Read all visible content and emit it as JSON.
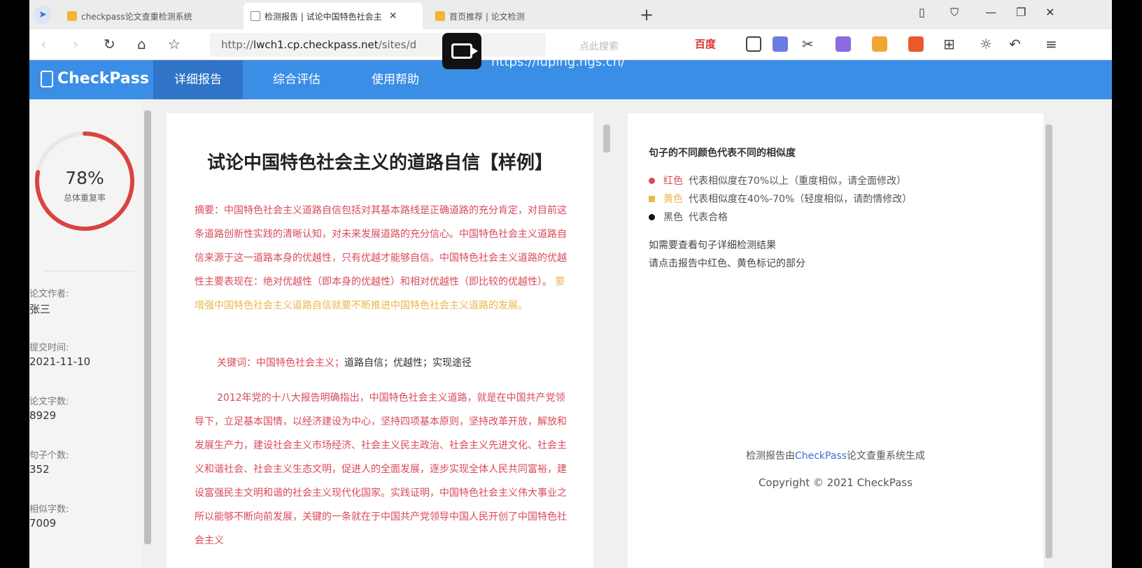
{
  "browser": {
    "tabs": [
      {
        "label": "checkpass论文查重检测系统",
        "active": false
      },
      {
        "label": "检测报告 | 试论中国特色社会主",
        "active": true
      },
      {
        "label": "首页推荐 | 论文检测",
        "active": false
      }
    ],
    "url_prefix": "http://",
    "url_host": "lwch1.cp.checkpass.net",
    "url_path": "/sites/d",
    "search_placeholder": "点此搜索",
    "search_engine": "百度",
    "overlay_url": "https://luping.hgs.cn/"
  },
  "header": {
    "logo": "CheckPass",
    "nav": [
      {
        "label": "详细报告",
        "active": true
      },
      {
        "label": "综合评估",
        "active": false
      },
      {
        "label": "使用帮助",
        "active": false
      }
    ],
    "brand_color": "#3a8ee6"
  },
  "summary": {
    "percent": "78%",
    "percent_value": 0.78,
    "percent_label": "总体重复率",
    "fields": [
      {
        "label": "论文作者:",
        "value": "张三"
      },
      {
        "label": "提交时间:",
        "value": "2021-11-10"
      },
      {
        "label": "论文字数:",
        "value": "8929"
      },
      {
        "label": "句子个数:",
        "value": "352"
      },
      {
        "label": "相似字数:",
        "value": "7009"
      }
    ]
  },
  "document": {
    "title": "试论中国特色社会主义的道路自信【样例】",
    "abstract_red": "摘要：中国特色社会主义道路自信包括对其基本路线是正确道路的充分肯定，对目前这条道路创新性实践的清晰认知，对未来发展道路的充分信心。中国特色社会主义道路自信来源于这一道路本身的优越性，只有优越才能够自信。中国特色社会主义道路的优越性主要表现在：绝对优越性（即本身的优越性）和相对优越性（即比较的优越性）。",
    "abstract_yellow": "要增强中国特色社会主义道路自信就要不断推进中国特色社会主义道路的发展。",
    "keywords_label": "关键词：",
    "keywords_red": "中国特色社会主义；",
    "keywords_black": "道路自信；优越性；实现途径",
    "body_red": "2012年党的十八大报告明确指出，中国特色社会主义道路，就是在中国共产党领导下，立足基本国情，以经济建设为中心，坚持四项基本原则，坚持改革开放，解放和发展生产力，建设社会主义市场经济、社会主义民主政治、社会主义先进文化、社会主义和谐社会、社会主义生态文明，促进人的全面发展，逐步实现全体人民共同富裕，建设富强民主文明和谐的社会主义现代化国家。实践证明，中国特色社会主义伟大事业之所以能够不断向前发展，关键的一条就在于中国共产党领导中国人民开创了中国特色社会主义"
  },
  "legend": {
    "title": "句子的不同颜色代表不同的相似度",
    "items": [
      {
        "name": "红色",
        "desc": "代表相似度在70%以上（重度相似，请全面修改）",
        "color": "#d94a5a"
      },
      {
        "name": "黄色",
        "desc": "代表相似度在40%-70%（轻度相似，请酌情修改）",
        "color": "#e8b84a"
      },
      {
        "name": "黑色",
        "desc": "代表合格",
        "color": "#111111"
      }
    ],
    "hint_line1": "如需要查看句子详细检测结果",
    "hint_line2": "请点击报告中红色、黄色标记的部分",
    "footer_prefix": "检测报告由",
    "footer_brand": "CheckPass",
    "footer_suffix": "论文查重系统生成",
    "copyright": "Copyright © 2021 CheckPass"
  }
}
